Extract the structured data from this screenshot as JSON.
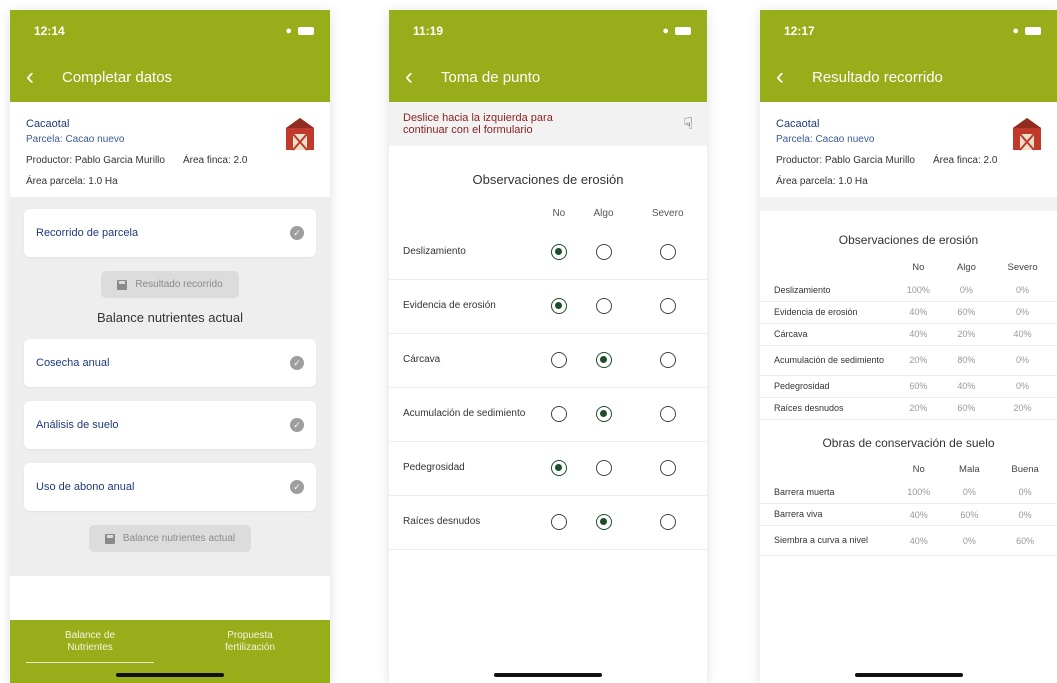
{
  "screens": [
    {
      "time": "12:14",
      "title": "Completar datos",
      "info": {
        "farm": "Cacaotal",
        "parcel": "Parcela: Cacao nuevo",
        "producer": "Productor: Pablo Garcia Murillo",
        "farm_area": "Área finca: 2.0",
        "parcel_area": "Área parcela: 1.0 Ha"
      },
      "card_recorrido": "Recorrido de parcela",
      "btn_resultado": "Resultado recorrido",
      "section_title": "Balance nutrientes actual",
      "card_cosecha": "Cosecha anual",
      "card_analisis": "Análisis de suelo",
      "card_abono": "Uso de abono anual",
      "btn_balance": "Balance nutrientes actual",
      "nav": {
        "item1_line1": "Balance de",
        "item1_line2": "Nutrientes",
        "item2_line1": "Propuesta",
        "item2_line2": "fertilización"
      }
    },
    {
      "time": "11:19",
      "title": "Toma de punto",
      "hint_line1": "Deslice hacia la izquierda para",
      "hint_line2": "continuar con el formulario",
      "obs_title": "Observaciones de erosión",
      "columns": [
        "No",
        "Algo",
        "Severo"
      ],
      "rows": [
        {
          "label": "Deslizamiento",
          "selected": "No"
        },
        {
          "label": "Evidencia de erosión",
          "selected": "No"
        },
        {
          "label": "Cárcava",
          "selected": "Algo"
        },
        {
          "label": "Acumulación de sedimiento",
          "selected": "Algo"
        },
        {
          "label": "Pedegrosidad",
          "selected": "No"
        },
        {
          "label": "Raíces desnudos",
          "selected": "Algo"
        }
      ]
    },
    {
      "time": "12:17",
      "title": "Resultado recorrido",
      "info": {
        "farm": "Cacaotal",
        "parcel": "Parcela: Cacao nuevo",
        "producer": "Productor: Pablo Garcia Murillo",
        "farm_area": "Área finca: 2.0",
        "parcel_area": "Área parcela: 1.0 Ha"
      },
      "erosion": {
        "title": "Observaciones de erosión",
        "columns": [
          "No",
          "Algo",
          "Severo"
        ],
        "rows": [
          {
            "label": "Deslizamiento",
            "values": [
              "100%",
              "0%",
              "0%"
            ]
          },
          {
            "label": "Evidencia de erosión",
            "values": [
              "40%",
              "60%",
              "0%"
            ]
          },
          {
            "label": "Cárcava",
            "values": [
              "40%",
              "20%",
              "40%"
            ]
          },
          {
            "label": "Acumulación de sedimiento",
            "values": [
              "20%",
              "80%",
              "0%"
            ]
          },
          {
            "label": "Pedegrosidad",
            "values": [
              "60%",
              "40%",
              "0%"
            ]
          },
          {
            "label": "Raíces desnudos",
            "values": [
              "20%",
              "60%",
              "20%"
            ]
          }
        ]
      },
      "conservation": {
        "title": "Obras de conservación de suelo",
        "columns": [
          "No",
          "Mala",
          "Buena"
        ],
        "rows": [
          {
            "label": "Barrera muerta",
            "values": [
              "100%",
              "0%",
              "0%"
            ]
          },
          {
            "label": "Barrera viva",
            "values": [
              "40%",
              "60%",
              "0%"
            ]
          },
          {
            "label": "Siembra a curva a nivel",
            "values": [
              "40%",
              "0%",
              "60%"
            ]
          }
        ]
      }
    }
  ]
}
